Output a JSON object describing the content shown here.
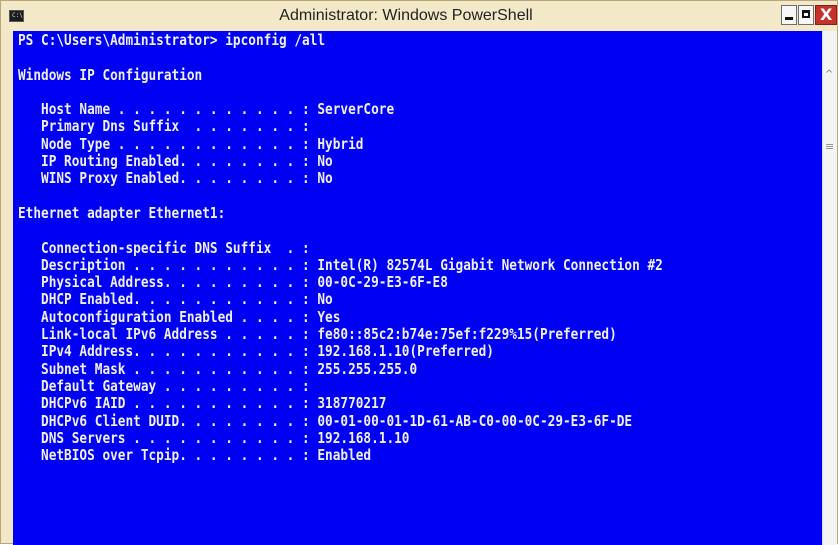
{
  "window": {
    "title": "Administrator: Windows PowerShell",
    "icon": "console-icon",
    "icon_text": "C:\\",
    "controls": [
      "minimize-icon",
      "maximize-icon",
      "close-icon"
    ],
    "close_glyph": "X"
  },
  "scrollbar": {
    "up_arrow": "^",
    "grip": "≡"
  },
  "console": {
    "background": "#0000f2",
    "foreground": "#f0f0f0",
    "lines": [
      "PS C:\\Users\\Administrator> ipconfig /all",
      "",
      "Windows IP Configuration",
      "",
      "   Host Name . . . . . . . . . . . . : ServerCore",
      "   Primary Dns Suffix  . . . . . . . :",
      "   Node Type . . . . . . . . . . . . : Hybrid",
      "   IP Routing Enabled. . . . . . . . : No",
      "   WINS Proxy Enabled. . . . . . . . : No",
      "",
      "Ethernet adapter Ethernet1:",
      "",
      "   Connection-specific DNS Suffix  . :",
      "   Description . . . . . . . . . . . : Intel(R) 82574L Gigabit Network Connection #2",
      "   Physical Address. . . . . . . . . : 00-0C-29-E3-6F-E8",
      "   DHCP Enabled. . . . . . . . . . . : No",
      "   Autoconfiguration Enabled . . . . : Yes",
      "   Link-local IPv6 Address . . . . . : fe80::85c2:b74e:75ef:f229%15(Preferred)",
      "   IPv4 Address. . . . . . . . . . . : 192.168.1.10(Preferred)",
      "   Subnet Mask . . . . . . . . . . . : 255.255.255.0",
      "   Default Gateway . . . . . . . . . :",
      "   DHCPv6 IAID . . . . . . . . . . . : 318770217",
      "   DHCPv6 Client DUID. . . . . . . . : 00-01-00-01-1D-61-AB-C0-00-0C-29-E3-6F-DE",
      "   DNS Servers . . . . . . . . . . . : 192.168.1.10",
      "   NetBIOS over Tcpip. . . . . . . . : Enabled"
    ]
  }
}
